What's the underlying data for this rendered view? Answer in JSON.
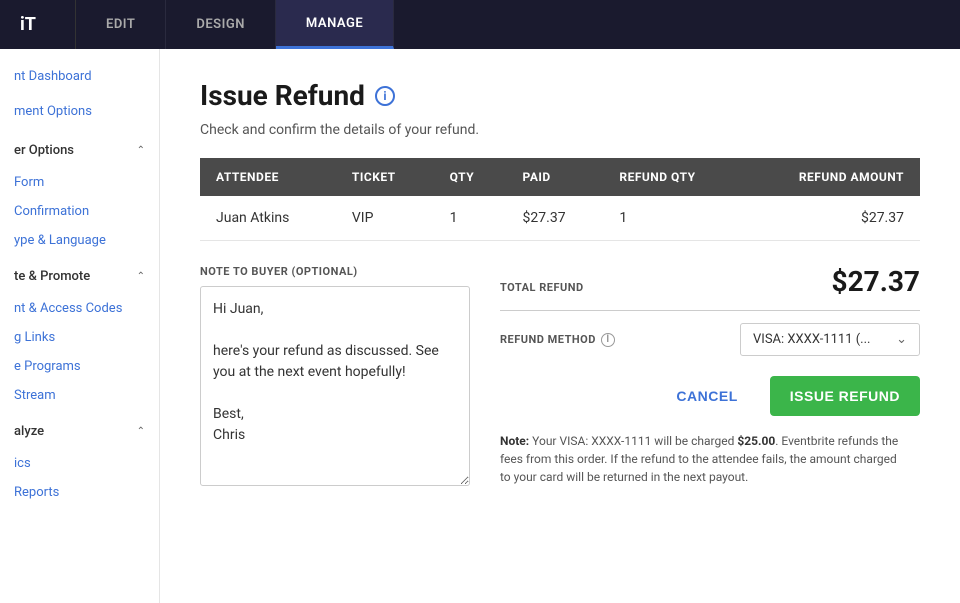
{
  "topNav": {
    "logo": "iT",
    "tabs": [
      {
        "label": "EDIT",
        "active": false
      },
      {
        "label": "DESIGN",
        "active": false
      },
      {
        "label": "MANAGE",
        "active": true
      }
    ]
  },
  "sidebar": {
    "items": [
      {
        "label": "nt Dashboard",
        "type": "link",
        "indent": 0
      },
      {
        "label": "ment Options",
        "type": "link",
        "indent": 0
      },
      {
        "label": "er Options",
        "type": "section",
        "indent": 0,
        "expanded": true
      },
      {
        "label": "Form",
        "type": "link",
        "indent": 1
      },
      {
        "label": "Confirmation",
        "type": "link",
        "indent": 1
      },
      {
        "label": "ype & Language",
        "type": "link",
        "indent": 1
      },
      {
        "label": "te & Promote",
        "type": "section",
        "indent": 0,
        "expanded": true
      },
      {
        "label": "nt & Access Codes",
        "type": "link",
        "indent": 1
      },
      {
        "label": "g Links",
        "type": "link",
        "indent": 1
      },
      {
        "label": "e Programs",
        "type": "link",
        "indent": 1
      },
      {
        "label": "Stream",
        "type": "link",
        "indent": 1
      },
      {
        "label": "alyze",
        "type": "section",
        "indent": 0,
        "expanded": true
      },
      {
        "label": "ics",
        "type": "link",
        "indent": 1
      },
      {
        "label": "Reports",
        "type": "link",
        "indent": 1
      }
    ]
  },
  "page": {
    "title": "Issue Refund",
    "subtitle": "Check and confirm the details of your refund.",
    "infoIconLabel": "i"
  },
  "table": {
    "headers": [
      "ATTENDEE",
      "TICKET",
      "QTY",
      "PAID",
      "REFUND QTY",
      "REFUND AMOUNT"
    ],
    "rows": [
      {
        "attendee": "Juan Atkins",
        "ticket": "VIP",
        "qty": "1",
        "paid": "$27.37",
        "refundQty": "1",
        "refundAmount": "$27.37"
      }
    ]
  },
  "form": {
    "noteLabel": "NOTE TO BUYER (OPTIONAL)",
    "noteValue": "Hi Juan,\n\nhere's your refund as discussed. See you at the next event hopefully!\n\nBest,\nChris",
    "totalRefundLabel": "TOTAL REFUND",
    "totalRefundAmount": "$27.37",
    "refundMethodLabel": "REFUND METHOD",
    "refundMethodValue": "VISA: XXXX-1111 (...",
    "cancelLabel": "CANCEL",
    "issueRefundLabel": "ISSUE REFUND",
    "noteText": "Note: Your VISA: XXXX-1111 will be charged $25.00. Eventbrite refunds the fees from this order. If the refund to the attendee fails, the amount charged to your card will be returned in the next payout."
  }
}
